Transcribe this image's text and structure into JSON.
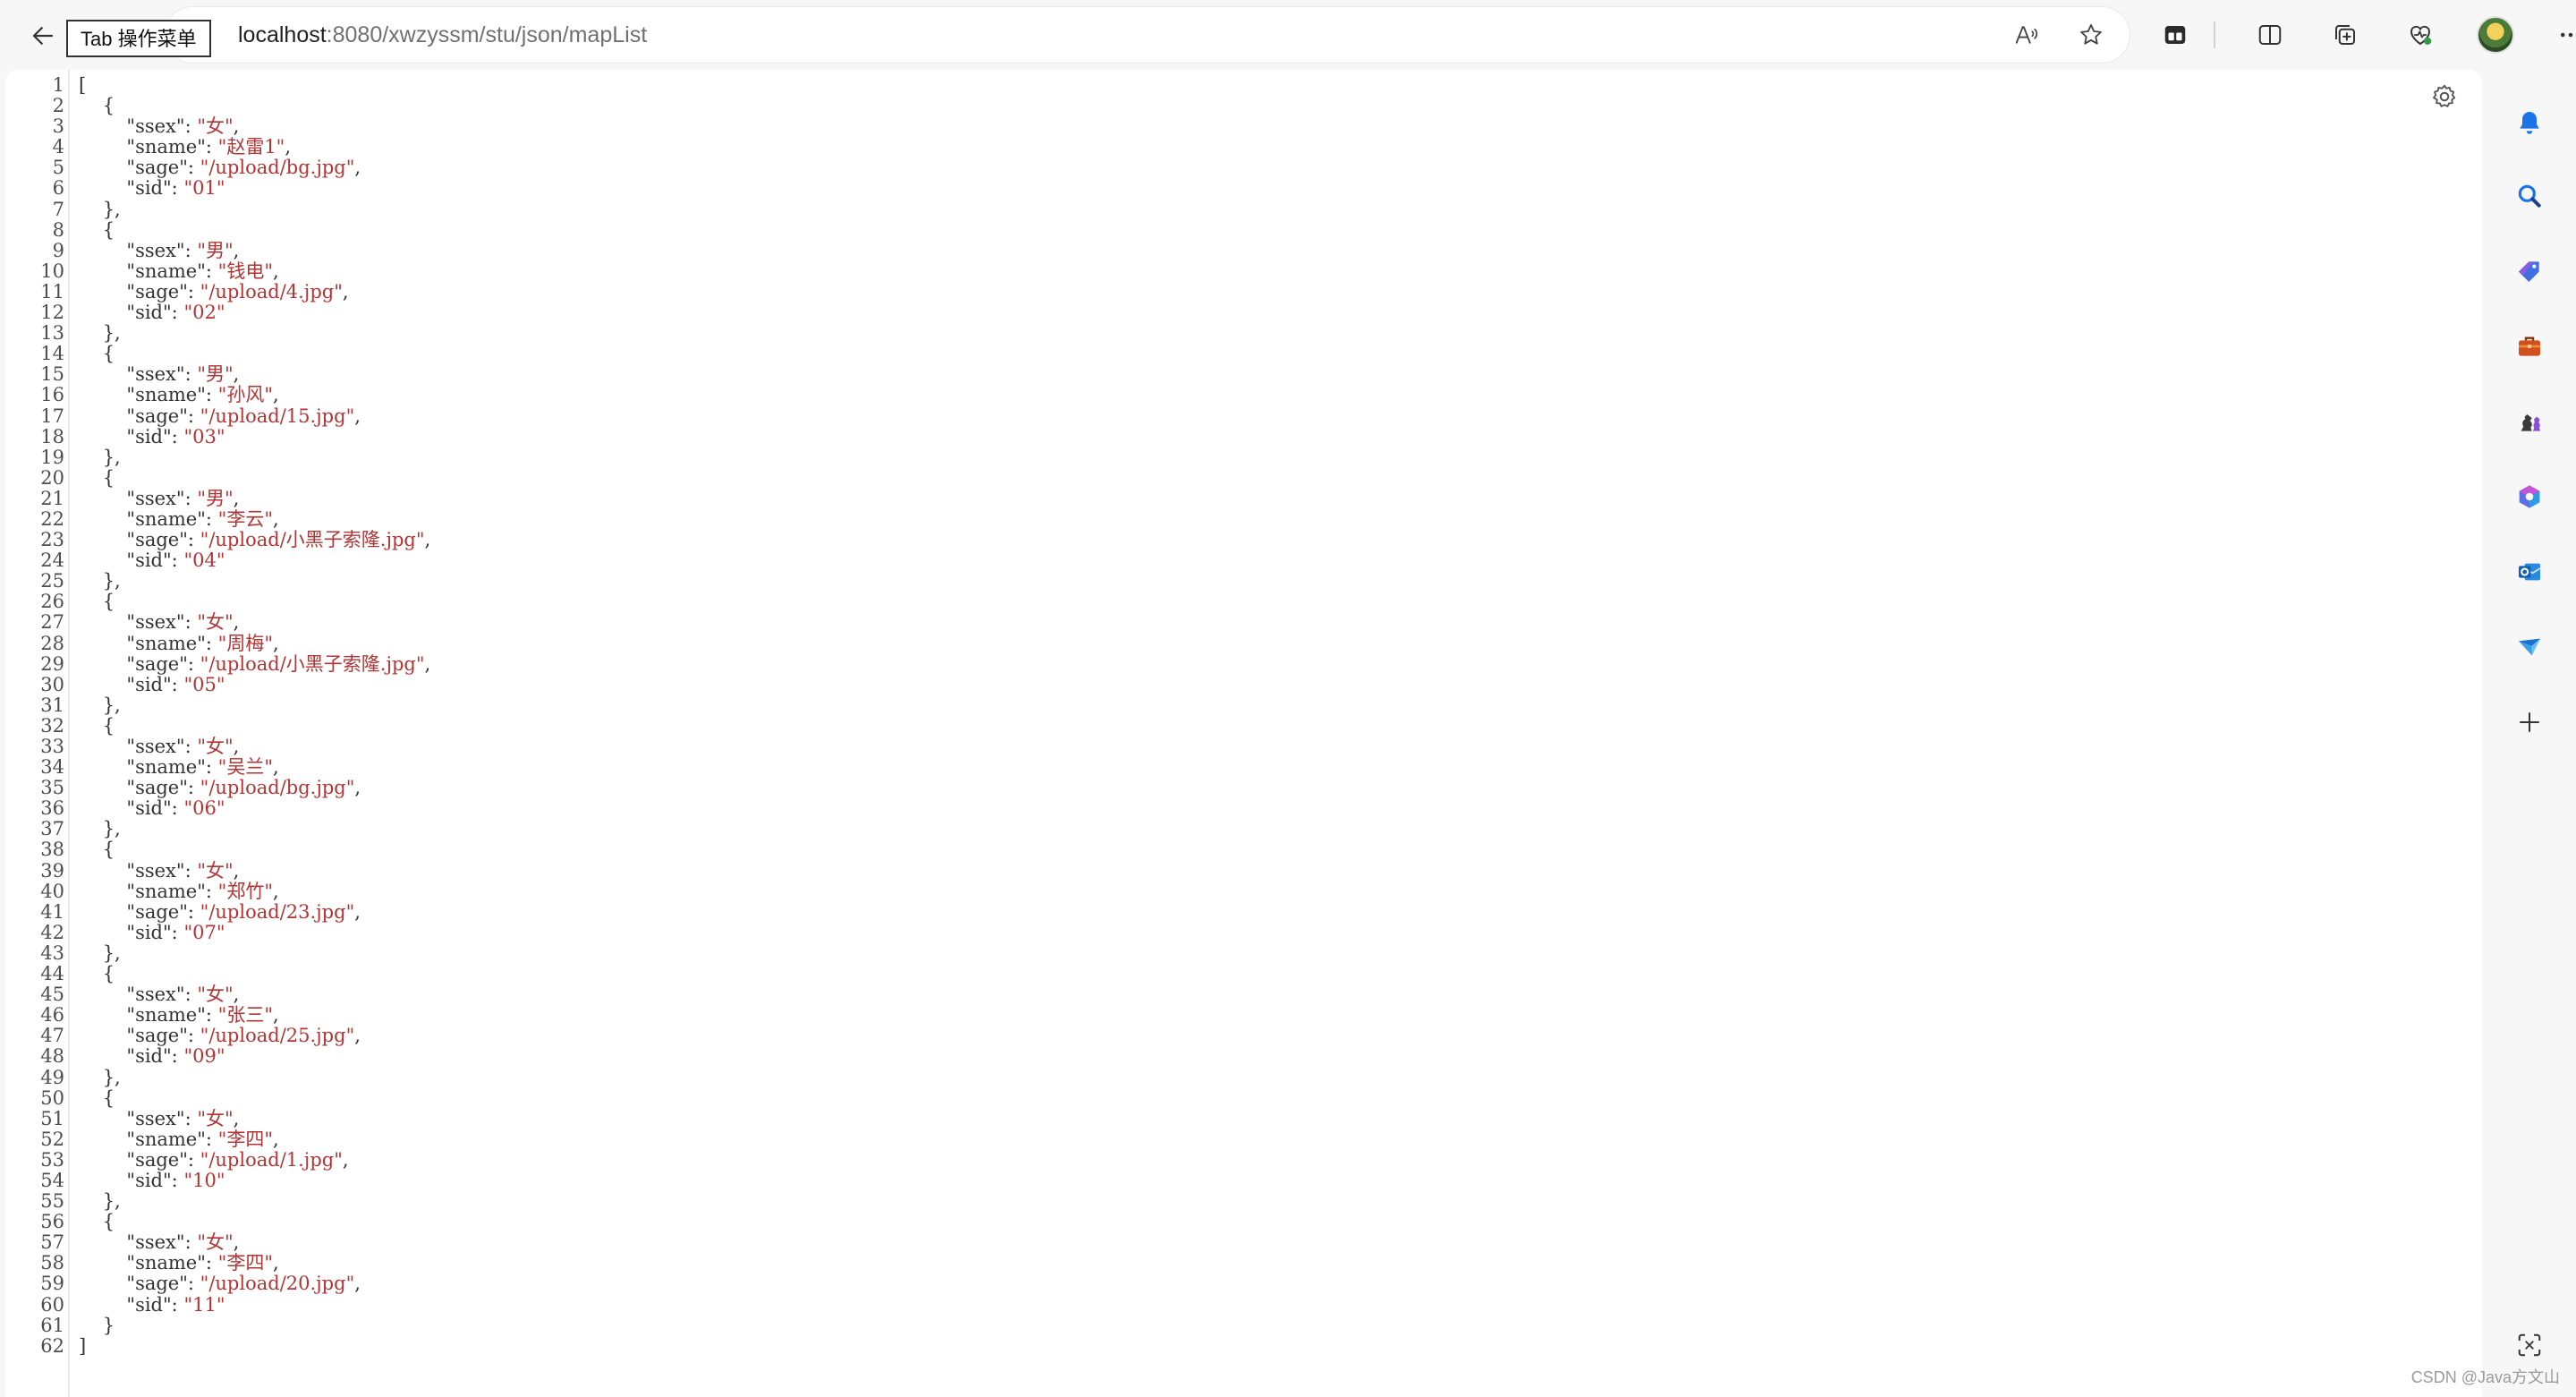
{
  "browser": {
    "tooltip": "Tab 操作菜单",
    "url_host": "localhost",
    "url_path": ":8080/xwzyssm/stu/json/mapList",
    "toolbar_icons": [
      "back-arrow-icon",
      "read-aloud-icon",
      "favorite-star-icon",
      "tabs-overview-icon",
      "split-screen-icon",
      "collections-icon",
      "browser-essentials-icon",
      "profile-avatar",
      "more-menu-icon"
    ],
    "sidebar_icons": [
      "bell-icon",
      "search-icon",
      "shopping-tag-icon",
      "tools-briefcase-icon",
      "games-chess-icon",
      "office-icon",
      "outlook-icon",
      "drop-icon",
      "add-icon",
      "screenshot-icon"
    ]
  },
  "json_view": {
    "records": [
      {
        "ssex": "女",
        "sname": "赵雷1",
        "sage": "/upload/bg.jpg",
        "sid": "01"
      },
      {
        "ssex": "男",
        "sname": "钱电",
        "sage": "/upload/4.jpg",
        "sid": "02"
      },
      {
        "ssex": "男",
        "sname": "孙风",
        "sage": "/upload/15.jpg",
        "sid": "03"
      },
      {
        "ssex": "男",
        "sname": "李云",
        "sage": "/upload/小黑子索隆.jpg",
        "sid": "04"
      },
      {
        "ssex": "女",
        "sname": "周梅",
        "sage": "/upload/小黑子索隆.jpg",
        "sid": "05"
      },
      {
        "ssex": "女",
        "sname": "吴兰",
        "sage": "/upload/bg.jpg",
        "sid": "06"
      },
      {
        "ssex": "女",
        "sname": "郑竹",
        "sage": "/upload/23.jpg",
        "sid": "07"
      },
      {
        "ssex": "女",
        "sname": "张三",
        "sage": "/upload/25.jpg",
        "sid": "09"
      },
      {
        "ssex": "女",
        "sname": "李四",
        "sage": "/upload/1.jpg",
        "sid": "10"
      },
      {
        "ssex": "女",
        "sname": "李四",
        "sage": "/upload/20.jpg",
        "sid": "11"
      }
    ],
    "colors": {
      "string": "#b33434",
      "key": "#333333",
      "line_number": "#4d4d4d"
    }
  },
  "watermark": "CSDN @Java方文山"
}
